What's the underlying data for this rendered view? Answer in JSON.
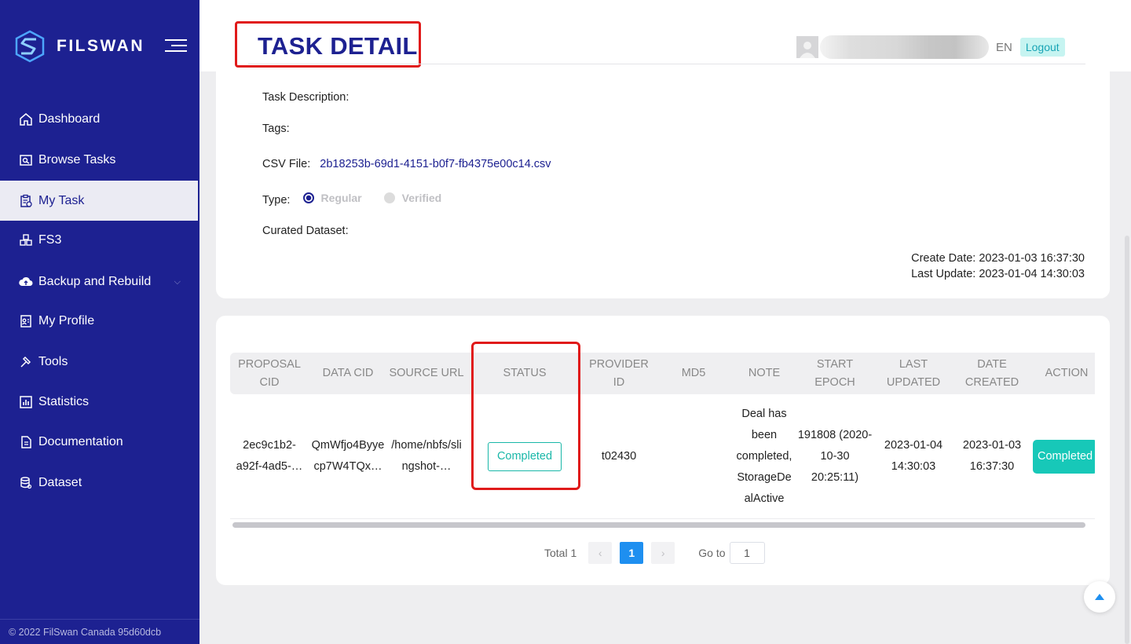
{
  "brand": {
    "name": "FILSWAN"
  },
  "sidebar": {
    "items": [
      {
        "label": "Dashboard",
        "icon": "home-icon"
      },
      {
        "label": "Browse Tasks",
        "icon": "search-list-icon"
      },
      {
        "label": "My Task",
        "icon": "clipboard-icon",
        "active": true
      },
      {
        "label": "FS3",
        "icon": "cubes-icon"
      },
      {
        "label": "Backup and Rebuild",
        "icon": "cloud-upload-icon"
      },
      {
        "label": "My Profile",
        "icon": "profile-card-icon"
      },
      {
        "label": "Tools",
        "icon": "hammer-icon"
      },
      {
        "label": "Statistics",
        "icon": "bar-chart-icon"
      },
      {
        "label": "Documentation",
        "icon": "document-icon"
      },
      {
        "label": "Dataset",
        "icon": "database-icon"
      }
    ],
    "footer": "© 2022 FilSwan Canada 95d60dcb"
  },
  "header": {
    "title": "TASK DETAIL",
    "lang": "EN",
    "logout": "Logout"
  },
  "detail": {
    "task_description_label": "Task Description:",
    "tags_label": "Tags:",
    "csv_label": "CSV File:",
    "csv_file": "2b18253b-69d1-4151-b0f7-fb4375e00c14.csv",
    "type_label": "Type:",
    "type_options": [
      "Regular",
      "Verified"
    ],
    "type_selected": "Regular",
    "curated_label": "Curated Dataset:",
    "create_date": "Create Date: 2023-01-03 16:37:30",
    "last_update": "Last Update: 2023-01-04 14:30:03"
  },
  "table": {
    "columns": [
      "PROPOSAL CID",
      "DATA CID",
      "SOURCE URL",
      "STATUS",
      "PROVIDER ID",
      "MD5",
      "NOTE",
      "START EPOCH",
      "LAST UPDATED",
      "DATE CREATED",
      "ACTION"
    ],
    "rows": [
      {
        "proposal_cid": "2ec9c1b2-a92f-4ad5-…",
        "data_cid": "QmWfjo4Byye cp7W4TQx…",
        "source_url": "/home/nbfs/sli ngshot-…",
        "status": "Completed",
        "provider_id": "t02430",
        "md5": "",
        "note": "Deal has been completed, StorageDe alActive",
        "start_epoch": "191808 (2020-10-30 20:25:11)",
        "last_updated": "2023-01-04 14:30:03",
        "date_created": "2023-01-03 16:37:30",
        "action": "Completed"
      }
    ]
  },
  "pagination": {
    "total": "Total 1",
    "prev": "‹",
    "next": "›",
    "current": "1",
    "goto_label": "Go to",
    "goto_value": "1"
  },
  "colors": {
    "sidebar": "#1d2191",
    "accent": "#1d2191",
    "status": "#19b7a8",
    "highlight": "#e01a1a",
    "page_active": "#1e8ff0"
  }
}
